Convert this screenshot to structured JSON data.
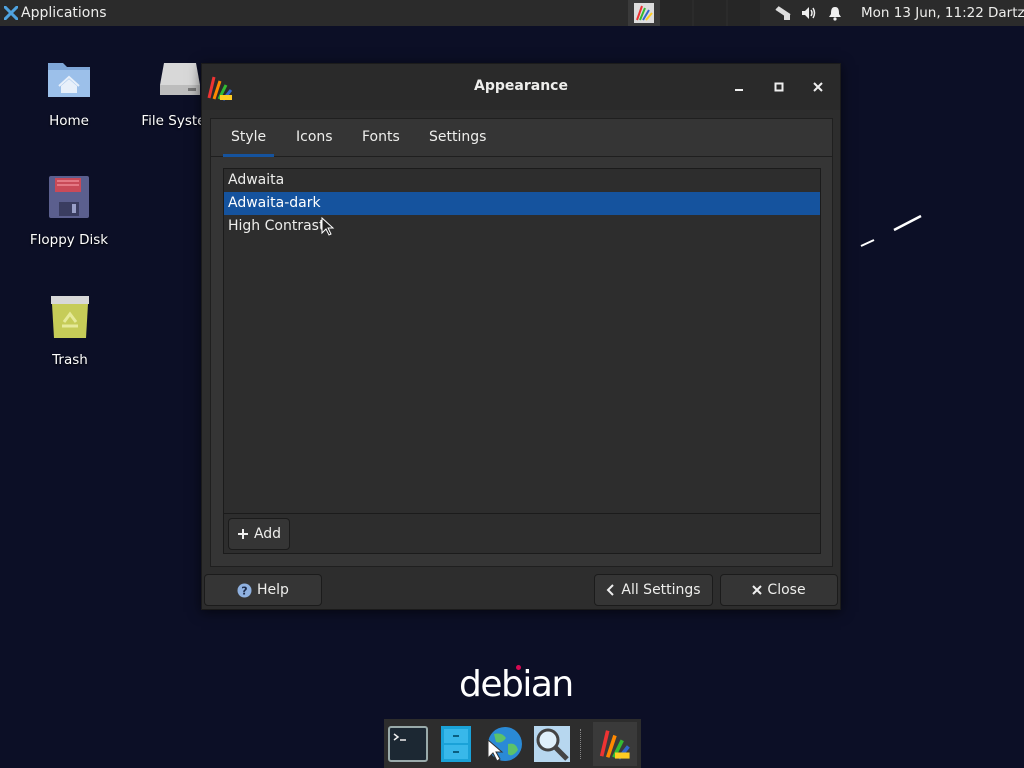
{
  "top_panel": {
    "applications_label": "Applications",
    "clock": "Mon 13 Jun, 11:22",
    "user": "Dartz"
  },
  "desktop": {
    "icons": [
      {
        "label": "Home",
        "icon": "home-folder-icon"
      },
      {
        "label": "File System",
        "icon": "drive-icon"
      },
      {
        "label": "Floppy Disk",
        "icon": "floppy-icon"
      },
      {
        "label": "Trash",
        "icon": "trash-icon"
      }
    ]
  },
  "window": {
    "title": "Appearance",
    "tabs": [
      {
        "label": "Style",
        "active": true
      },
      {
        "label": "Icons",
        "active": false
      },
      {
        "label": "Fonts",
        "active": false
      },
      {
        "label": "Settings",
        "active": false
      }
    ],
    "themes": [
      {
        "name": "Adwaita",
        "selected": false
      },
      {
        "name": "Adwaita-dark",
        "selected": true
      },
      {
        "name": "High Contrast",
        "selected": false
      }
    ],
    "add_label": "Add",
    "help_label": "Help",
    "all_settings_label": "All Settings",
    "close_label": "Close"
  },
  "branding": {
    "logo_text": "debian"
  },
  "colors": {
    "desktop_bg": "#0c0f26",
    "panel_bg": "#2b2b2b",
    "selection": "#15539e",
    "debian_red": "#d70a53"
  }
}
